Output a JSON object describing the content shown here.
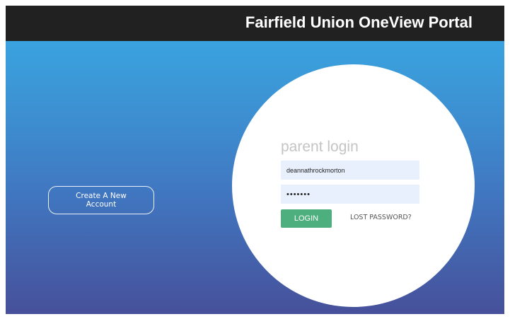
{
  "header": {
    "title": "Fairfield Union OneView Portal"
  },
  "create_account": {
    "label": "Create A New Account"
  },
  "login": {
    "heading": "parent login",
    "username_value": "deannathrockmorton",
    "password_value": "•••••••",
    "login_label": "LOGIN",
    "lost_password_label": "LOST PASSWORD?"
  },
  "colors": {
    "topbar": "#212121",
    "gradient_top": "#3aa3df",
    "gradient_bottom": "#47509a",
    "login_button": "#4caf7d",
    "input_background": "#e8f0fe"
  }
}
